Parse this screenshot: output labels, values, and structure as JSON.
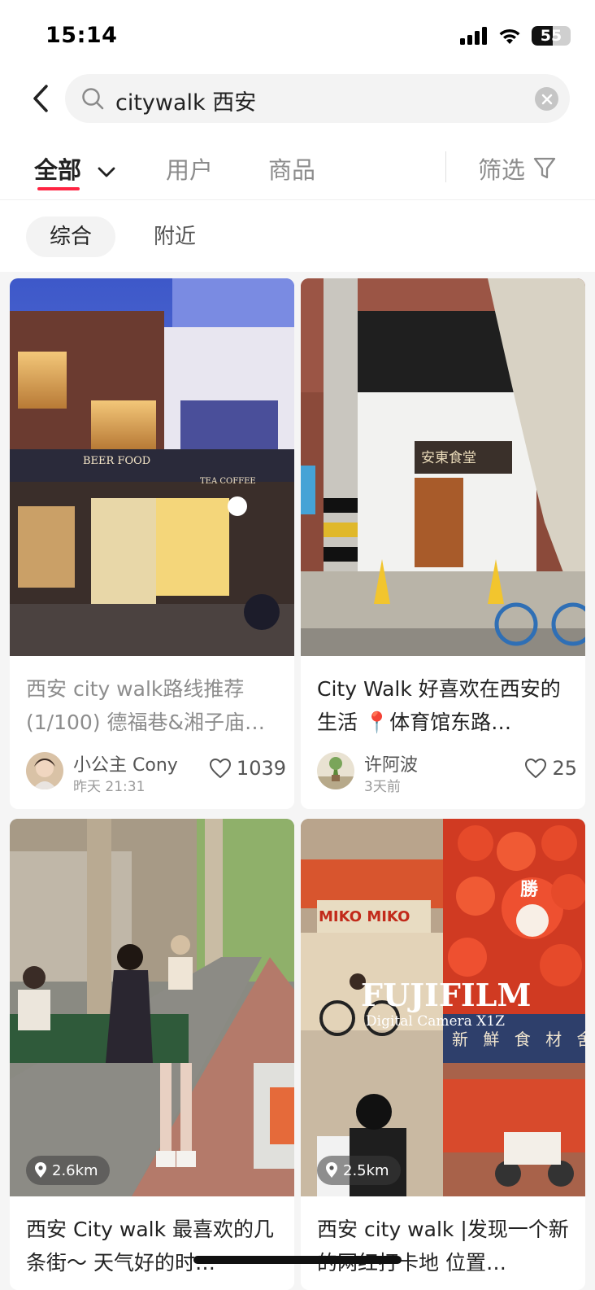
{
  "status_bar": {
    "time": "15:14",
    "battery": "55",
    "battery_level": 0.55
  },
  "search": {
    "query": "citywalk 西安"
  },
  "tabs": {
    "all": "全部",
    "users": "用户",
    "goods": "商品",
    "filter": "筛选"
  },
  "subtabs": {
    "general": "综合",
    "nearby": "附近"
  },
  "posts": [
    {
      "title": "西安 city walk路线推荐 (1/100) 德福巷&湘子庙…",
      "author": "小公主 Cony",
      "time": "昨天 21:31",
      "likes": "1039",
      "read": true
    },
    {
      "title": "City Walk 好喜欢在西安的生活 📍体育馆东路…",
      "author": "许阿波",
      "time": "3天前",
      "likes": "25",
      "read": false
    },
    {
      "title": "西安 City walk 最喜欢的几条街～ 天气好的时…",
      "distance": "2.6km"
    },
    {
      "title": "西安 city walk |发现一个新的网红打卡地 位置…",
      "distance": "2.5km"
    }
  ],
  "image_text": {
    "beer_food": "BEER FOOD",
    "tea_coffee": "TEA COFFEE",
    "shop_sign": "安東食堂",
    "miko": "MIKO MIKO",
    "fujifilm": "FUJIFILM",
    "digital": "Digital Camera X1Z",
    "daruma": "勝",
    "shop_chars": "新 鮮 食 材 舍"
  },
  "colors": {
    "accent": "#ff2442",
    "feed_bg": "#f5f5f5"
  }
}
